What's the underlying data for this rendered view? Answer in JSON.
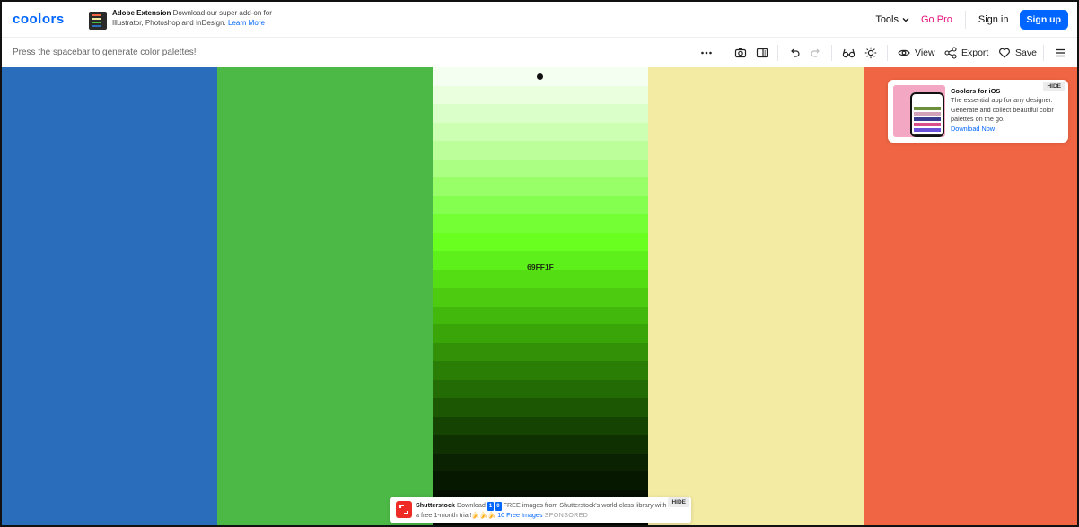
{
  "header": {
    "logo": "coolors",
    "extension": {
      "title": "Adobe Extension",
      "desc": "Download our super add-on for Illustrator, Photoshop and InDesign.",
      "link": "Learn More"
    },
    "tools_label": "Tools",
    "gopro_label": "Go Pro",
    "signin_label": "Sign in",
    "signup_label": "Sign up"
  },
  "toolbar": {
    "hint": "Press the spacebar to generate color palettes!",
    "view_label": "View",
    "export_label": "Export",
    "save_label": "Save",
    "icons": [
      "more-icon",
      "camera-icon",
      "panel-icon",
      "undo-icon",
      "redo-icon",
      "glasses-icon",
      "sun-icon",
      "eye-icon",
      "share-icon",
      "heart-icon",
      "menu-icon"
    ]
  },
  "palette": {
    "colors": [
      "#2A6EBB",
      "#4CB846",
      "#69FF1F",
      "#F3EBA3",
      "#F06543"
    ],
    "active_index": 2,
    "active_hex_label": "69FF1F",
    "shades": [
      "#F5FFF1",
      "#E9FFDD",
      "#DBFFC8",
      "#CCFFB2",
      "#BCFF9A",
      "#ABFF82",
      "#98FF69",
      "#85FF4F",
      "#74FF35",
      "#69FF1F",
      "#5EF01A",
      "#55DD14",
      "#4CCB10",
      "#43B80C",
      "#3AA508",
      "#329107",
      "#2A7E05",
      "#236B04",
      "#1C5803",
      "#154402",
      "#0F3101",
      "#0A2201",
      "#071801",
      "#040F00",
      "#020800"
    ]
  },
  "ios_ad": {
    "title": "Coolors for iOS",
    "text": "The essential app for any designer. Generate and collect beautiful color palettes on the go.",
    "link": "Download Now",
    "hide": "HIDE"
  },
  "ss_ad": {
    "brand": "Shutterstock",
    "pre": "Download",
    "num1": "1",
    "num2": "0",
    "mid": "FREE images from Shutterstock's world-class library with a free 1-month trial!",
    "emoji": "🍌🍌🍌",
    "link": "10 Free Images",
    "sponsored": "SPONSORED",
    "hide": "HIDE"
  },
  "colors": {
    "accent": "#0066FF",
    "gopro": "#E5137D"
  }
}
